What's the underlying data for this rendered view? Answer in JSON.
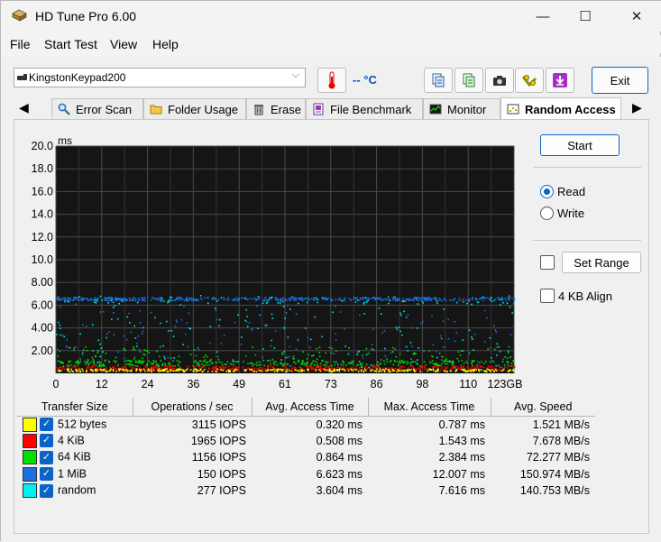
{
  "window": {
    "title": "HD Tune Pro 6.00"
  },
  "window_controls": {
    "minimize": "—",
    "maximize": "☐",
    "close": "✕"
  },
  "menu": {
    "items": [
      "File",
      "Start Test",
      "View",
      "Help"
    ]
  },
  "toolbar": {
    "drive": "KingstonKeypad200",
    "temperature": "-- °C",
    "exit_label": "Exit",
    "icons": [
      "thermometer-icon",
      "copy-info-icon",
      "copy-text-icon",
      "camera-icon",
      "options-icon",
      "save-icon"
    ]
  },
  "tabs": [
    {
      "label": "Error Scan",
      "icon": "magnifier-icon"
    },
    {
      "label": "Folder Usage",
      "icon": "folder-icon"
    },
    {
      "label": "Erase",
      "icon": "trash-icon"
    },
    {
      "label": "File Benchmark",
      "icon": "file-bench-icon"
    },
    {
      "label": "Monitor",
      "icon": "monitor-icon"
    },
    {
      "label": "Random Access",
      "icon": "random-access-icon",
      "active": true
    }
  ],
  "controls": {
    "start_label": "Start",
    "read_label": "Read",
    "write_label": "Write",
    "selected": "Read",
    "set_range_label": "Set Range",
    "align_label": "4 KB Align",
    "range_checked": false,
    "align_checked": false
  },
  "chart_data": {
    "type": "scatter",
    "ylabel": "ms",
    "y_ticks": [
      "20.0",
      "18.0",
      "16.0",
      "14.0",
      "12.0",
      "10.0",
      "8.00",
      "6.00",
      "4.00",
      "2.00"
    ],
    "ylim": [
      0,
      20
    ],
    "x_ticks": [
      "0",
      "12",
      "24",
      "36",
      "49",
      "61",
      "73",
      "86",
      "98",
      "110",
      "123GB"
    ],
    "xlim": [
      0,
      123
    ],
    "background": "#151515",
    "grid": true,
    "series": [
      {
        "name": "512 bytes",
        "color": "#ffff00",
        "avg": 0.32,
        "max": 0.787
      },
      {
        "name": "4 KiB",
        "color": "#ff0000",
        "avg": 0.508,
        "max": 1.543
      },
      {
        "name": "64 KiB",
        "color": "#00dd00",
        "avg": 0.864,
        "max": 2.384
      },
      {
        "name": "1 MiB",
        "color": "#1a6fe0",
        "avg": 6.623,
        "max": 12.007
      },
      {
        "name": "random",
        "color": "#00e8e8",
        "avg": 3.604,
        "max": 7.616
      }
    ]
  },
  "results": {
    "headers": [
      "Transfer Size",
      "Operations / sec",
      "Avg. Access Time",
      "Max. Access Time",
      "Avg. Speed"
    ],
    "rows": [
      {
        "size": "512 bytes",
        "color": "#ffff00",
        "ops": "3115 IOPS",
        "avg": "0.320 ms",
        "max": "0.787 ms",
        "speed": "1.521 MB/s"
      },
      {
        "size": "4 KiB",
        "color": "#ff0000",
        "ops": "1965 IOPS",
        "avg": "0.508 ms",
        "max": "1.543 ms",
        "speed": "7.678 MB/s"
      },
      {
        "size": "64 KiB",
        "color": "#00e000",
        "ops": "1156 IOPS",
        "avg": "0.864 ms",
        "max": "2.384 ms",
        "speed": "72.277 MB/s"
      },
      {
        "size": "1 MiB",
        "color": "#1a6fe0",
        "ops": "150 IOPS",
        "avg": "6.623 ms",
        "max": "12.007 ms",
        "speed": "150.974 MB/s"
      },
      {
        "size": "random",
        "color": "#00f0f0",
        "ops": "277 IOPS",
        "avg": "3.604 ms",
        "max": "7.616 ms",
        "speed": "140.753 MB/s"
      }
    ]
  }
}
